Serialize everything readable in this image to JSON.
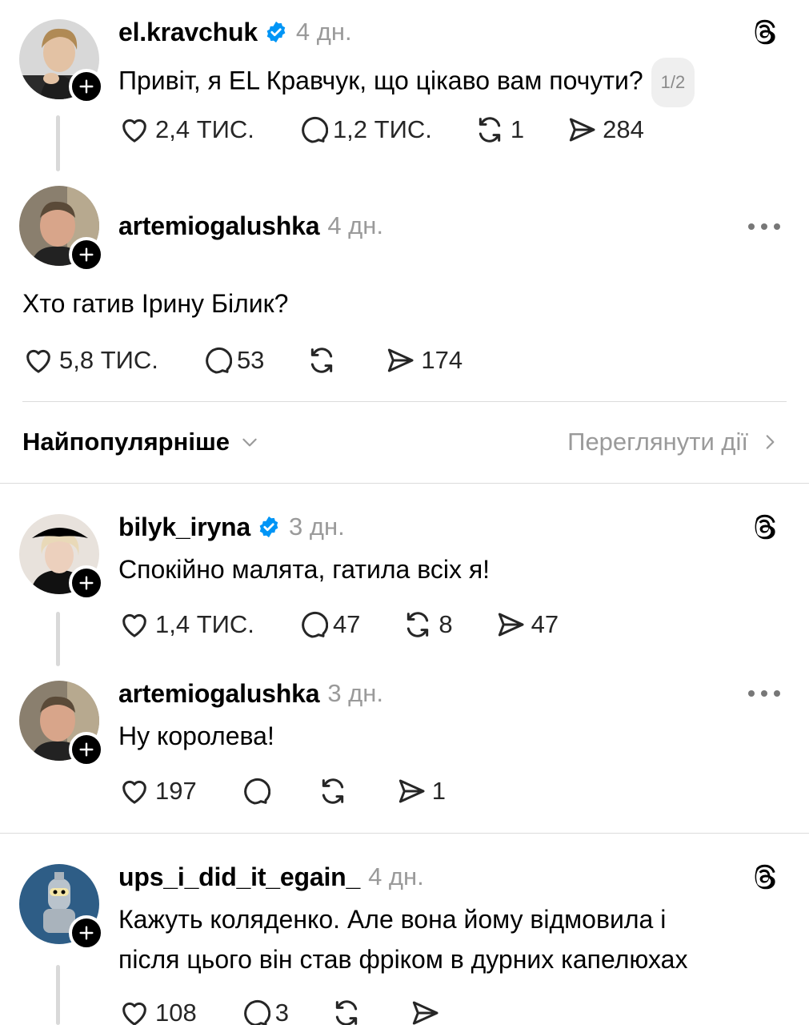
{
  "posts": [
    {
      "username": "el.kravchuk",
      "verified": true,
      "time": "4 дн.",
      "text": "Привіт, я EL Кравчук, що цікаво вам почути?",
      "page_indicator": "1/2",
      "likes": "2,4 ТИС.",
      "replies": "1,2 ТИС.",
      "reposts": "1",
      "shares": "284",
      "corner_icon": "threads-logo-icon"
    },
    {
      "username": "artemiogalushka",
      "verified": false,
      "time": "4 дн.",
      "text": "Хто гатив Ірину Білик?",
      "likes": "5,8 ТИС.",
      "replies": "53",
      "reposts": "",
      "shares": "174",
      "corner_icon": "more-icon"
    }
  ],
  "sort": {
    "label": "Найпопулярніше",
    "view_activity": "Переглянути дії"
  },
  "replies": [
    {
      "username": "bilyk_iryna",
      "verified": true,
      "time": "3 дн.",
      "text": "Спокійно малята, гатила всіх я!",
      "likes": "1,4 ТИС.",
      "replies": "47",
      "reposts": "8",
      "shares": "47",
      "corner_icon": "threads-logo-icon"
    },
    {
      "username": "artemiogalushka",
      "verified": false,
      "time": "3 дн.",
      "text": "Ну королева!",
      "likes": "197",
      "replies": "",
      "reposts": "",
      "shares": "1",
      "corner_icon": "more-icon"
    },
    {
      "username": "ups_i_did_it_egain_",
      "verified": false,
      "time": "4 дн.",
      "text_line1": "Кажуть коляденко. Але вона йому відмовила і",
      "text_line2": "після цього він став фріком в дурних капелюхах",
      "likes": "108",
      "replies": "3",
      "reposts": "",
      "shares": "",
      "corner_icon": "threads-logo-icon"
    }
  ],
  "colors": {
    "verified_blue": "#0095f6",
    "muted_text": "#9a9a9a",
    "divider": "#dcdcdc"
  }
}
